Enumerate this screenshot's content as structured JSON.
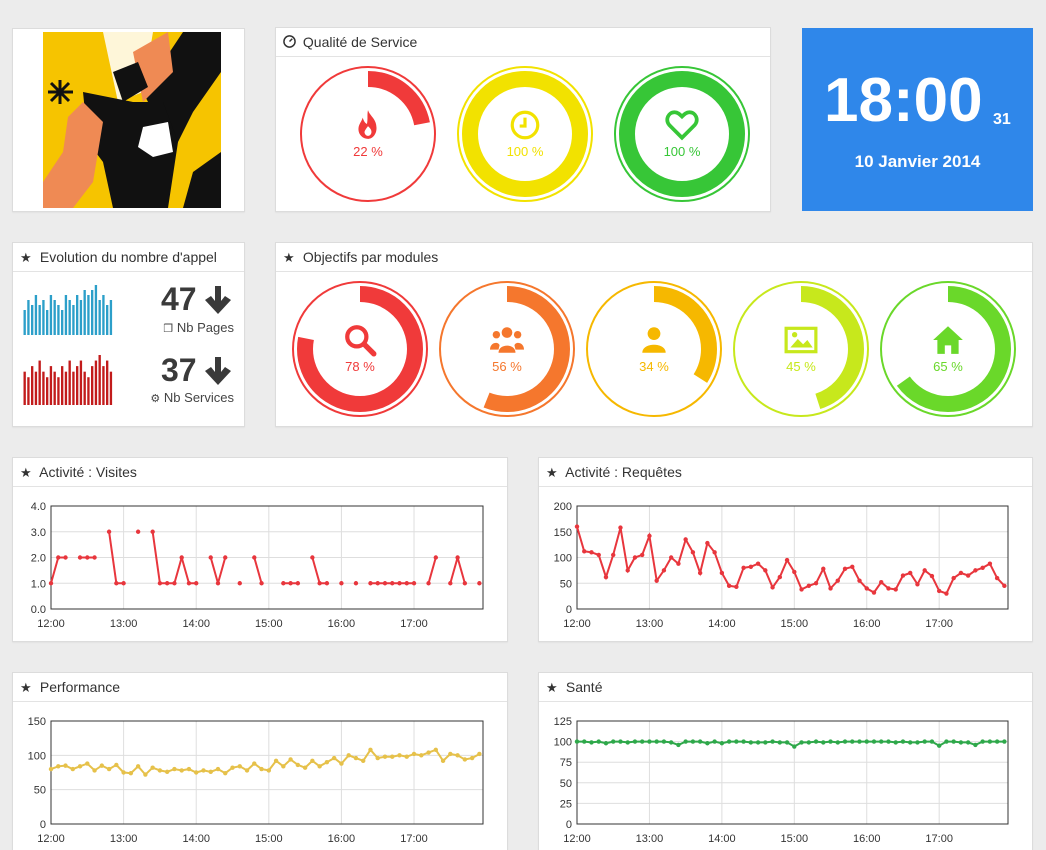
{
  "logo": {
    "alt": "logo-figure"
  },
  "quality": {
    "title": "Qualité de Service",
    "gauges": [
      {
        "icon": "fire-icon",
        "label": "22 %",
        "percent": 22,
        "color": "#f03a3a"
      },
      {
        "icon": "clock-icon",
        "label": "100 %",
        "percent": 100,
        "color": "#f2e200"
      },
      {
        "icon": "heart-icon",
        "label": "100 %",
        "percent": 100,
        "color": "#37c637"
      }
    ]
  },
  "clock": {
    "time": "18:00",
    "seconds": "31",
    "date": "10 Janvier 2014",
    "color": "#2f87ea"
  },
  "calls": {
    "title": "Evolution du nombre d'appel",
    "pages": {
      "count": "47",
      "label": "Nb Pages",
      "trend": "down",
      "values": [
        5,
        7,
        6,
        8,
        6,
        7,
        5,
        8,
        7,
        6,
        5,
        8,
        7,
        6,
        8,
        7,
        9,
        8,
        9,
        10,
        7,
        8,
        6,
        7
      ],
      "color": "#2c9fc9"
    },
    "services": {
      "count": "37",
      "label": "Nb Services",
      "trend": "down",
      "values": [
        6,
        5,
        7,
        6,
        8,
        6,
        5,
        7,
        6,
        5,
        7,
        6,
        8,
        6,
        7,
        8,
        6,
        5,
        7,
        8,
        9,
        7,
        8,
        6
      ],
      "color": "#c21b1b"
    }
  },
  "modules": {
    "title": "Objectifs par modules",
    "gauges": [
      {
        "icon": "search-icon",
        "label": "78 %",
        "percent": 78,
        "color": "#f03a3a"
      },
      {
        "icon": "users-icon",
        "label": "56 %",
        "percent": 56,
        "color": "#f5772d"
      },
      {
        "icon": "user-icon",
        "label": "34 %",
        "percent": 34,
        "color": "#f6b800"
      },
      {
        "icon": "image-icon",
        "label": "45 %",
        "percent": 45,
        "color": "#c7e81c"
      },
      {
        "icon": "home-icon",
        "label": "65 %",
        "percent": 65,
        "color": "#6ad82a"
      }
    ]
  },
  "chart_data": [
    {
      "type": "line",
      "title": "Activité : Visites",
      "color": "#e8363d",
      "ylim": [
        0,
        4
      ],
      "yticks": [
        "0.0",
        "1.0",
        "2.0",
        "3.0",
        "4.0"
      ],
      "xticks": [
        "12:00",
        "13:00",
        "14:00",
        "15:00",
        "16:00",
        "17:00"
      ],
      "xlim_hours": [
        12,
        17.95
      ],
      "grid": true,
      "legend": "none",
      "x": [
        12.0,
        12.1,
        12.2,
        12.4,
        12.5,
        12.6,
        12.8,
        12.9,
        13.0,
        13.2,
        13.4,
        13.5,
        13.6,
        13.7,
        13.8,
        13.9,
        14.0,
        14.2,
        14.3,
        14.4,
        14.6,
        14.8,
        14.9,
        15.2,
        15.3,
        15.4,
        15.6,
        15.7,
        15.8,
        16.0,
        16.2,
        16.4,
        16.5,
        16.6,
        16.7,
        16.8,
        16.9,
        17.0,
        17.2,
        17.3,
        17.5,
        17.6,
        17.7,
        17.9
      ],
      "y": [
        1,
        2,
        2,
        2,
        2,
        2,
        3,
        1,
        1,
        3,
        3,
        1,
        1,
        1,
        2,
        1,
        1,
        2,
        1,
        2,
        1,
        2,
        1,
        1,
        1,
        1,
        2,
        1,
        1,
        1,
        1,
        1,
        1,
        1,
        1,
        1,
        1,
        1,
        1,
        2,
        1,
        2,
        1,
        1
      ]
    },
    {
      "type": "line",
      "title": "Activité : Requêtes",
      "color": "#e8363d",
      "ylim": [
        0,
        200
      ],
      "yticks": [
        "0",
        "50",
        "100",
        "150",
        "200"
      ],
      "xticks": [
        "12:00",
        "13:00",
        "14:00",
        "15:00",
        "16:00",
        "17:00"
      ],
      "xlim_hours": [
        12,
        17.95
      ],
      "grid": true,
      "legend": "none",
      "x": [
        12.0,
        12.1,
        12.2,
        12.3,
        12.4,
        12.5,
        12.6,
        12.7,
        12.8,
        12.9,
        13.0,
        13.1,
        13.2,
        13.3,
        13.4,
        13.5,
        13.6,
        13.7,
        13.8,
        13.9,
        14.0,
        14.1,
        14.2,
        14.3,
        14.4,
        14.5,
        14.6,
        14.7,
        14.8,
        14.9,
        15.0,
        15.1,
        15.2,
        15.3,
        15.4,
        15.5,
        15.6,
        15.7,
        15.8,
        15.9,
        16.0,
        16.1,
        16.2,
        16.3,
        16.4,
        16.5,
        16.6,
        16.7,
        16.8,
        16.9,
        17.0,
        17.1,
        17.2,
        17.3,
        17.4,
        17.5,
        17.6,
        17.7,
        17.8,
        17.9
      ],
      "y": [
        160,
        112,
        110,
        105,
        62,
        105,
        158,
        75,
        100,
        105,
        142,
        55,
        75,
        100,
        88,
        135,
        110,
        70,
        128,
        110,
        70,
        45,
        43,
        80,
        82,
        88,
        75,
        42,
        62,
        95,
        72,
        38,
        45,
        50,
        78,
        40,
        55,
        78,
        82,
        55,
        40,
        32,
        52,
        40,
        38,
        65,
        70,
        48,
        75,
        64,
        35,
        30,
        60,
        70,
        65,
        75,
        80,
        88,
        60,
        45
      ]
    },
    {
      "type": "line",
      "title": "Performance",
      "color": "#e6c14a",
      "ylim": [
        0,
        150
      ],
      "yticks": [
        "0",
        "50",
        "100",
        "150"
      ],
      "xticks": [
        "12:00",
        "13:00",
        "14:00",
        "15:00",
        "16:00",
        "17:00"
      ],
      "xlim_hours": [
        12,
        17.95
      ],
      "grid": true,
      "legend": "none",
      "x": [
        12.0,
        12.1,
        12.2,
        12.3,
        12.4,
        12.5,
        12.6,
        12.7,
        12.8,
        12.9,
        13.0,
        13.1,
        13.2,
        13.3,
        13.4,
        13.5,
        13.6,
        13.7,
        13.8,
        13.9,
        14.0,
        14.1,
        14.2,
        14.3,
        14.4,
        14.5,
        14.6,
        14.7,
        14.8,
        14.9,
        15.0,
        15.1,
        15.2,
        15.3,
        15.4,
        15.5,
        15.6,
        15.7,
        15.8,
        15.9,
        16.0,
        16.1,
        16.2,
        16.3,
        16.4,
        16.5,
        16.6,
        16.7,
        16.8,
        16.9,
        17.0,
        17.1,
        17.2,
        17.3,
        17.4,
        17.5,
        17.6,
        17.7,
        17.8,
        17.9
      ],
      "y": [
        80,
        84,
        85,
        80,
        84,
        88,
        78,
        85,
        80,
        86,
        75,
        74,
        84,
        72,
        82,
        78,
        76,
        80,
        78,
        80,
        75,
        78,
        76,
        80,
        74,
        82,
        84,
        78,
        88,
        80,
        78,
        92,
        84,
        94,
        86,
        82,
        92,
        84,
        90,
        96,
        88,
        100,
        96,
        92,
        108,
        96,
        98,
        98,
        100,
        98,
        102,
        100,
        104,
        108,
        92,
        102,
        100,
        94,
        96,
        102
      ]
    },
    {
      "type": "line",
      "title": "Santé",
      "color": "#2ea84a",
      "ylim": [
        0,
        125
      ],
      "yticks": [
        "0",
        "25",
        "50",
        "75",
        "100",
        "125"
      ],
      "xticks": [
        "12:00",
        "13:00",
        "14:00",
        "15:00",
        "16:00",
        "17:00"
      ],
      "xlim_hours": [
        12,
        17.95
      ],
      "grid": true,
      "legend": "none",
      "x": [
        12.0,
        12.1,
        12.2,
        12.3,
        12.4,
        12.5,
        12.6,
        12.7,
        12.8,
        12.9,
        13.0,
        13.1,
        13.2,
        13.3,
        13.4,
        13.5,
        13.6,
        13.7,
        13.8,
        13.9,
        14.0,
        14.1,
        14.2,
        14.3,
        14.4,
        14.5,
        14.6,
        14.7,
        14.8,
        14.9,
        15.0,
        15.1,
        15.2,
        15.3,
        15.4,
        15.5,
        15.6,
        15.7,
        15.8,
        15.9,
        16.0,
        16.1,
        16.2,
        16.3,
        16.4,
        16.5,
        16.6,
        16.7,
        16.8,
        16.9,
        17.0,
        17.1,
        17.2,
        17.3,
        17.4,
        17.5,
        17.6,
        17.7,
        17.8,
        17.9
      ],
      "y": [
        100,
        100,
        99,
        100,
        98,
        100,
        100,
        99,
        100,
        100,
        100,
        100,
        100,
        99,
        96,
        100,
        100,
        100,
        98,
        100,
        98,
        100,
        100,
        100,
        99,
        99,
        99,
        100,
        99,
        99,
        94,
        99,
        99,
        100,
        99,
        100,
        99,
        100,
        100,
        100,
        100,
        100,
        100,
        100,
        99,
        100,
        99,
        99,
        100,
        100,
        95,
        100,
        100,
        99,
        99,
        96,
        100,
        100,
        100,
        100
      ]
    }
  ]
}
